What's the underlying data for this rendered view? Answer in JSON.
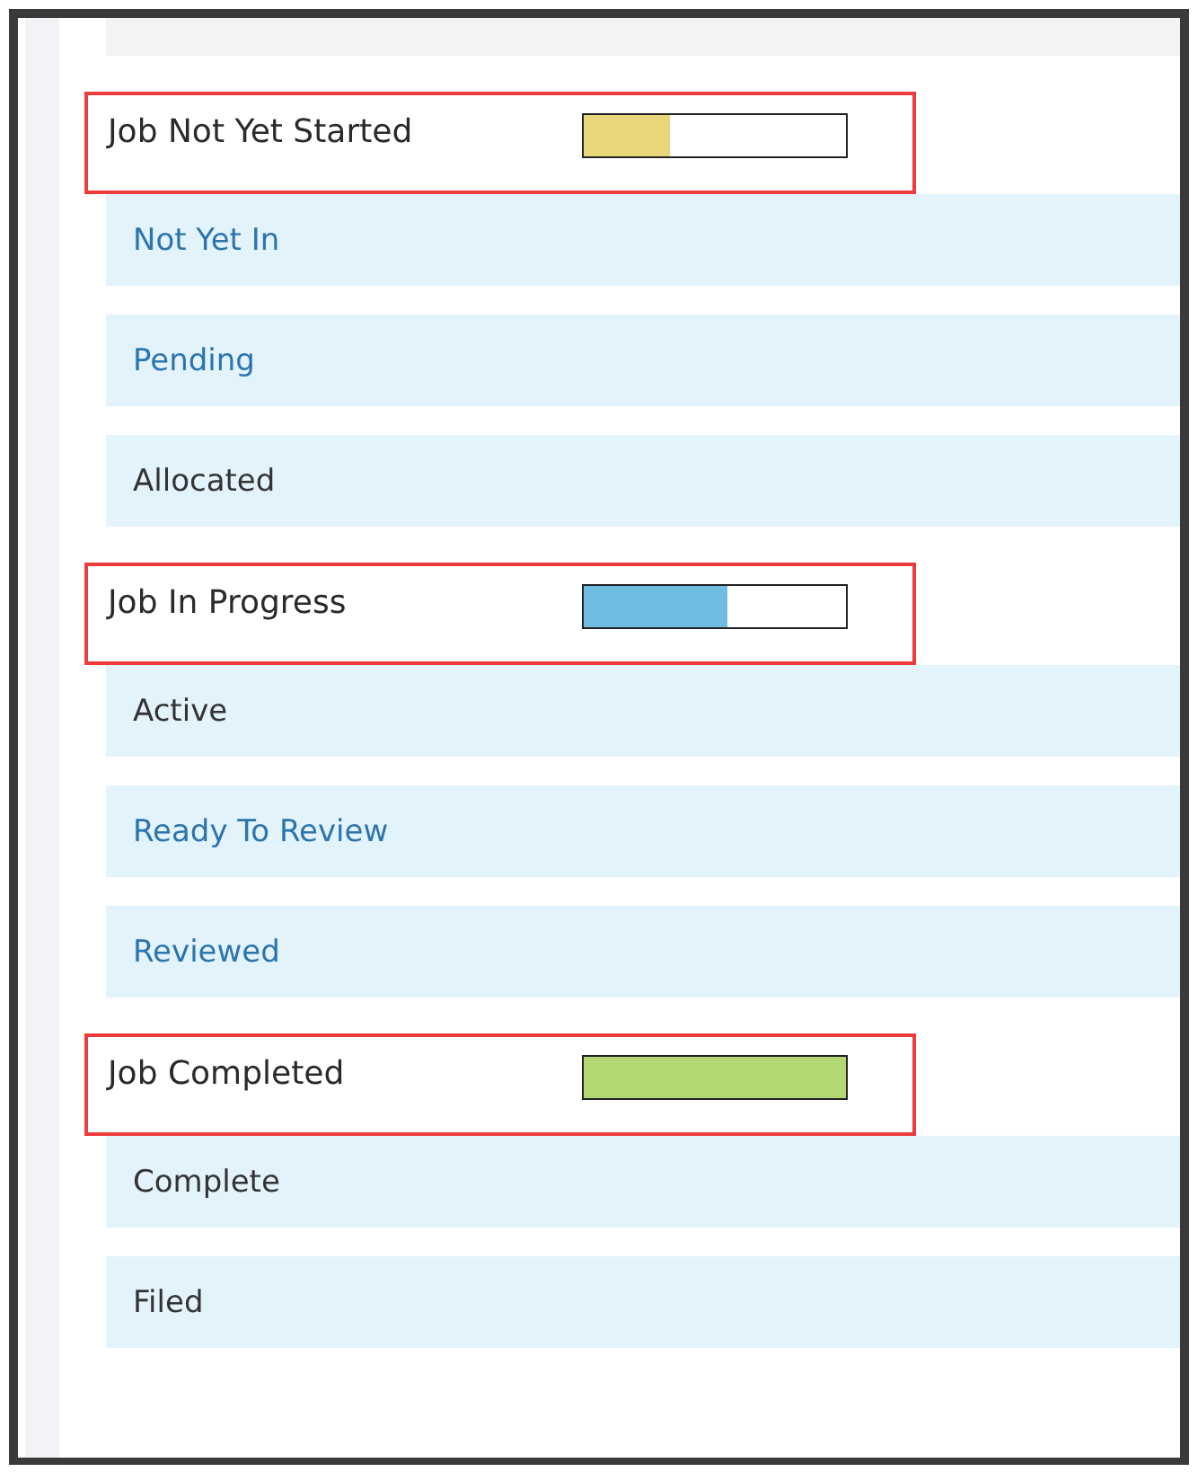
{
  "groups": [
    {
      "title": "Job Not Yet Started",
      "highlighted": true,
      "level": 0.33,
      "color": "#e8d77a",
      "items": [
        {
          "label": "Not Yet In",
          "kind": "link"
        },
        {
          "label": "Pending",
          "kind": "link"
        },
        {
          "label": "Allocated",
          "kind": "text"
        }
      ]
    },
    {
      "title": "Job In Progress",
      "highlighted": true,
      "level": 0.55,
      "color": "#6fbde0",
      "items": [
        {
          "label": "Active",
          "kind": "text"
        },
        {
          "label": "Ready To Review",
          "kind": "link"
        },
        {
          "label": "Reviewed",
          "kind": "link"
        }
      ]
    },
    {
      "title": "Job Completed",
      "highlighted": true,
      "level": 1,
      "color": "#b3d773",
      "items": [
        {
          "label": "Complete",
          "kind": "text"
        },
        {
          "label": "Filed",
          "kind": "text"
        }
      ]
    }
  ]
}
